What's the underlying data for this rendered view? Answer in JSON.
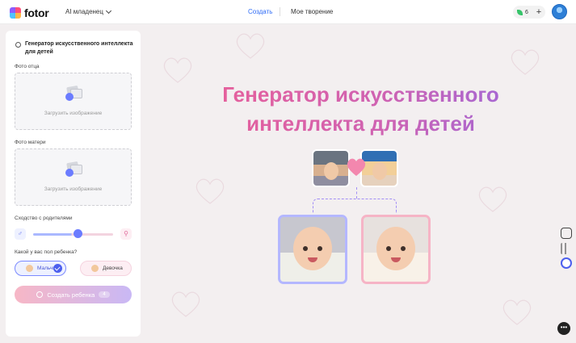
{
  "header": {
    "logo_text": "fotor",
    "model_select": "AI младенец",
    "nav_create": "Создать",
    "nav_mine": "Мое творение",
    "credits": "6",
    "plus": "+"
  },
  "panel": {
    "title": "Генератор искусственного интеллекта для детей",
    "father_label": "Фото отца",
    "mother_label": "Фото матери",
    "upload_text": "Загрузить изображение",
    "similarity_label": "Сходство с родителями",
    "similarity_value": 0.5,
    "gender_label": "Какой у вас пол ребенка?",
    "boy_label": "Мальчик",
    "girl_label": "Девочка",
    "boy_selected": true,
    "create_label": "Создать ребенка",
    "create_cost": "4"
  },
  "main": {
    "title_line1": "Генератор искусственного",
    "title_line2": "интеллекта для детей"
  },
  "colors": {
    "accent": "#2f6cf6",
    "title_start": "#ef5f92",
    "title_end": "#8f6ae6",
    "boy": "#7a89ff",
    "girl": "#f6b4c6"
  },
  "icons": [
    "settings-icon",
    "male-icon",
    "female-icon",
    "upload-icon",
    "heart-icon",
    "crop-icon",
    "grid-icon",
    "assistant-icon",
    "chat-icon"
  ]
}
